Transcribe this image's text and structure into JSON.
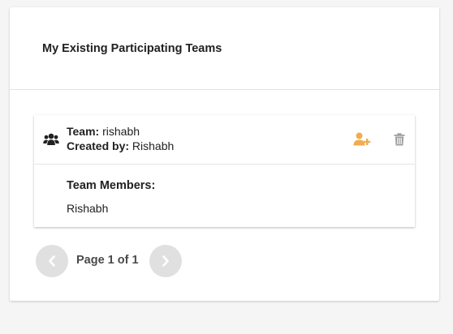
{
  "card": {
    "title": "My Existing Participating Teams"
  },
  "team": {
    "team_label": "Team:",
    "team_name": "rishabh",
    "created_by_label": "Created by:",
    "created_by": "Rishabh",
    "icon": "users-icon",
    "actions": [
      {
        "name": "add-member",
        "icon": "user-plus-icon",
        "color": "#f0ad4e"
      },
      {
        "name": "delete-team",
        "icon": "trash-icon",
        "color": "#9e9e9e"
      }
    ]
  },
  "members": {
    "label": "Team Members:",
    "items": [
      "Rishabh"
    ]
  },
  "pagination": {
    "text": "Page 1 of 1",
    "prev_icon": "chevron-left-icon",
    "next_icon": "chevron-right-icon"
  },
  "colors": {
    "accent": "#f0ad4e",
    "button_bg": "#e0e0e0"
  }
}
